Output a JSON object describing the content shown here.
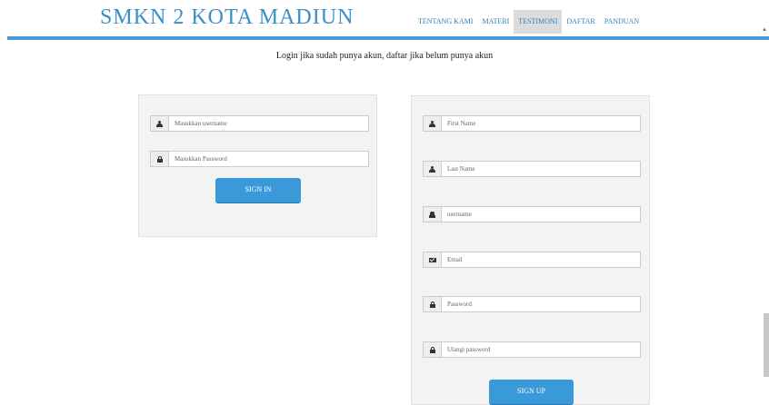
{
  "header": {
    "brand": "SMKN 2 KOTA MADIUN",
    "nav": [
      {
        "label": "TENTANG KAMI",
        "active": false
      },
      {
        "label": "MATERI",
        "active": false
      },
      {
        "label": "TESTIMONI",
        "active": true
      },
      {
        "label": "DAFTAR",
        "active": false
      },
      {
        "label": "PANDUAN",
        "active": false
      }
    ]
  },
  "subtitle": "Login jika sudah punya akun, daftar jika belum punya akun",
  "login": {
    "username_placeholder": "Masukkan username",
    "password_placeholder": "Masukkan Password",
    "submit_label": "SIGN IN"
  },
  "register": {
    "fields": [
      {
        "icon": "user-icon",
        "placeholder": "First Name"
      },
      {
        "icon": "user-icon",
        "placeholder": "Last Name"
      },
      {
        "icon": "id-icon",
        "placeholder": "username"
      },
      {
        "icon": "envelope-icon",
        "placeholder": "Email"
      },
      {
        "icon": "lock-icon",
        "placeholder": "Password"
      },
      {
        "icon": "lock-icon",
        "placeholder": "Ulangi password"
      }
    ],
    "submit_label": "SIGN UP"
  },
  "colors": {
    "accent": "#3a9ad9",
    "brand": "#3a8fc7",
    "panel": "#f3f3f3"
  }
}
